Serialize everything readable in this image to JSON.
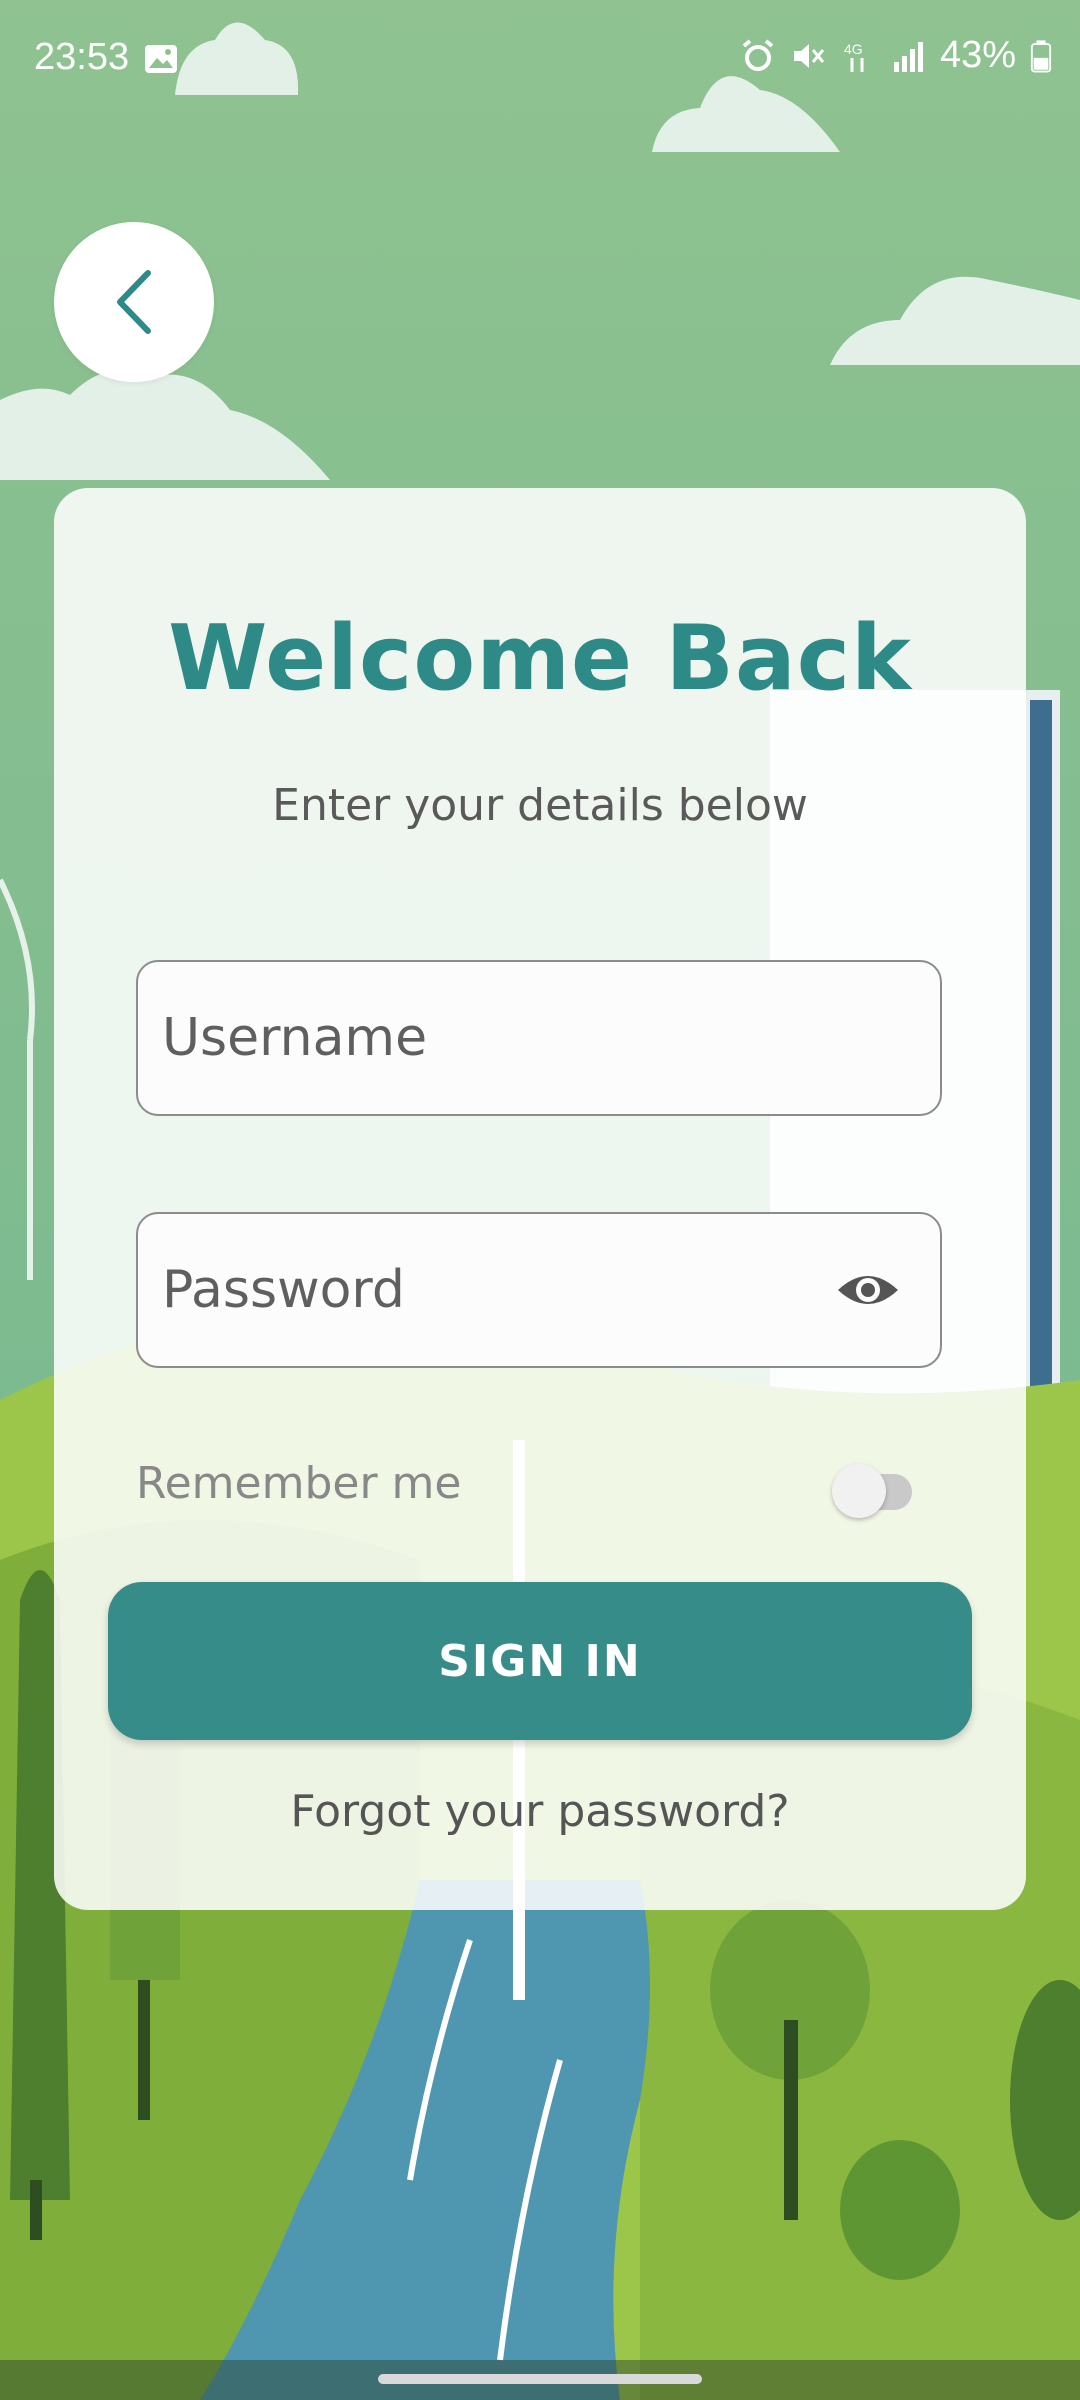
{
  "status_bar": {
    "time": "23:53",
    "battery": "43%",
    "icons": [
      "image-icon",
      "alarm-icon",
      "mute-icon",
      "4g-icon",
      "signal-icon",
      "battery-icon"
    ]
  },
  "back_button": {
    "icon": "chevron-left-icon"
  },
  "login": {
    "title": "Welcome Back",
    "subtitle": "Enter your details below",
    "username_placeholder": "Username",
    "password_placeholder": "Password",
    "remember_label": "Remember me",
    "remember_enabled": false,
    "sign_in_label": "SIGN IN",
    "forgot_label": "Forgot your password?"
  },
  "colors": {
    "accent": "#2e8a87",
    "button": "#368c89",
    "sky": "#8fc290",
    "grass": "#8cba3d",
    "river": "#4f97b0"
  }
}
